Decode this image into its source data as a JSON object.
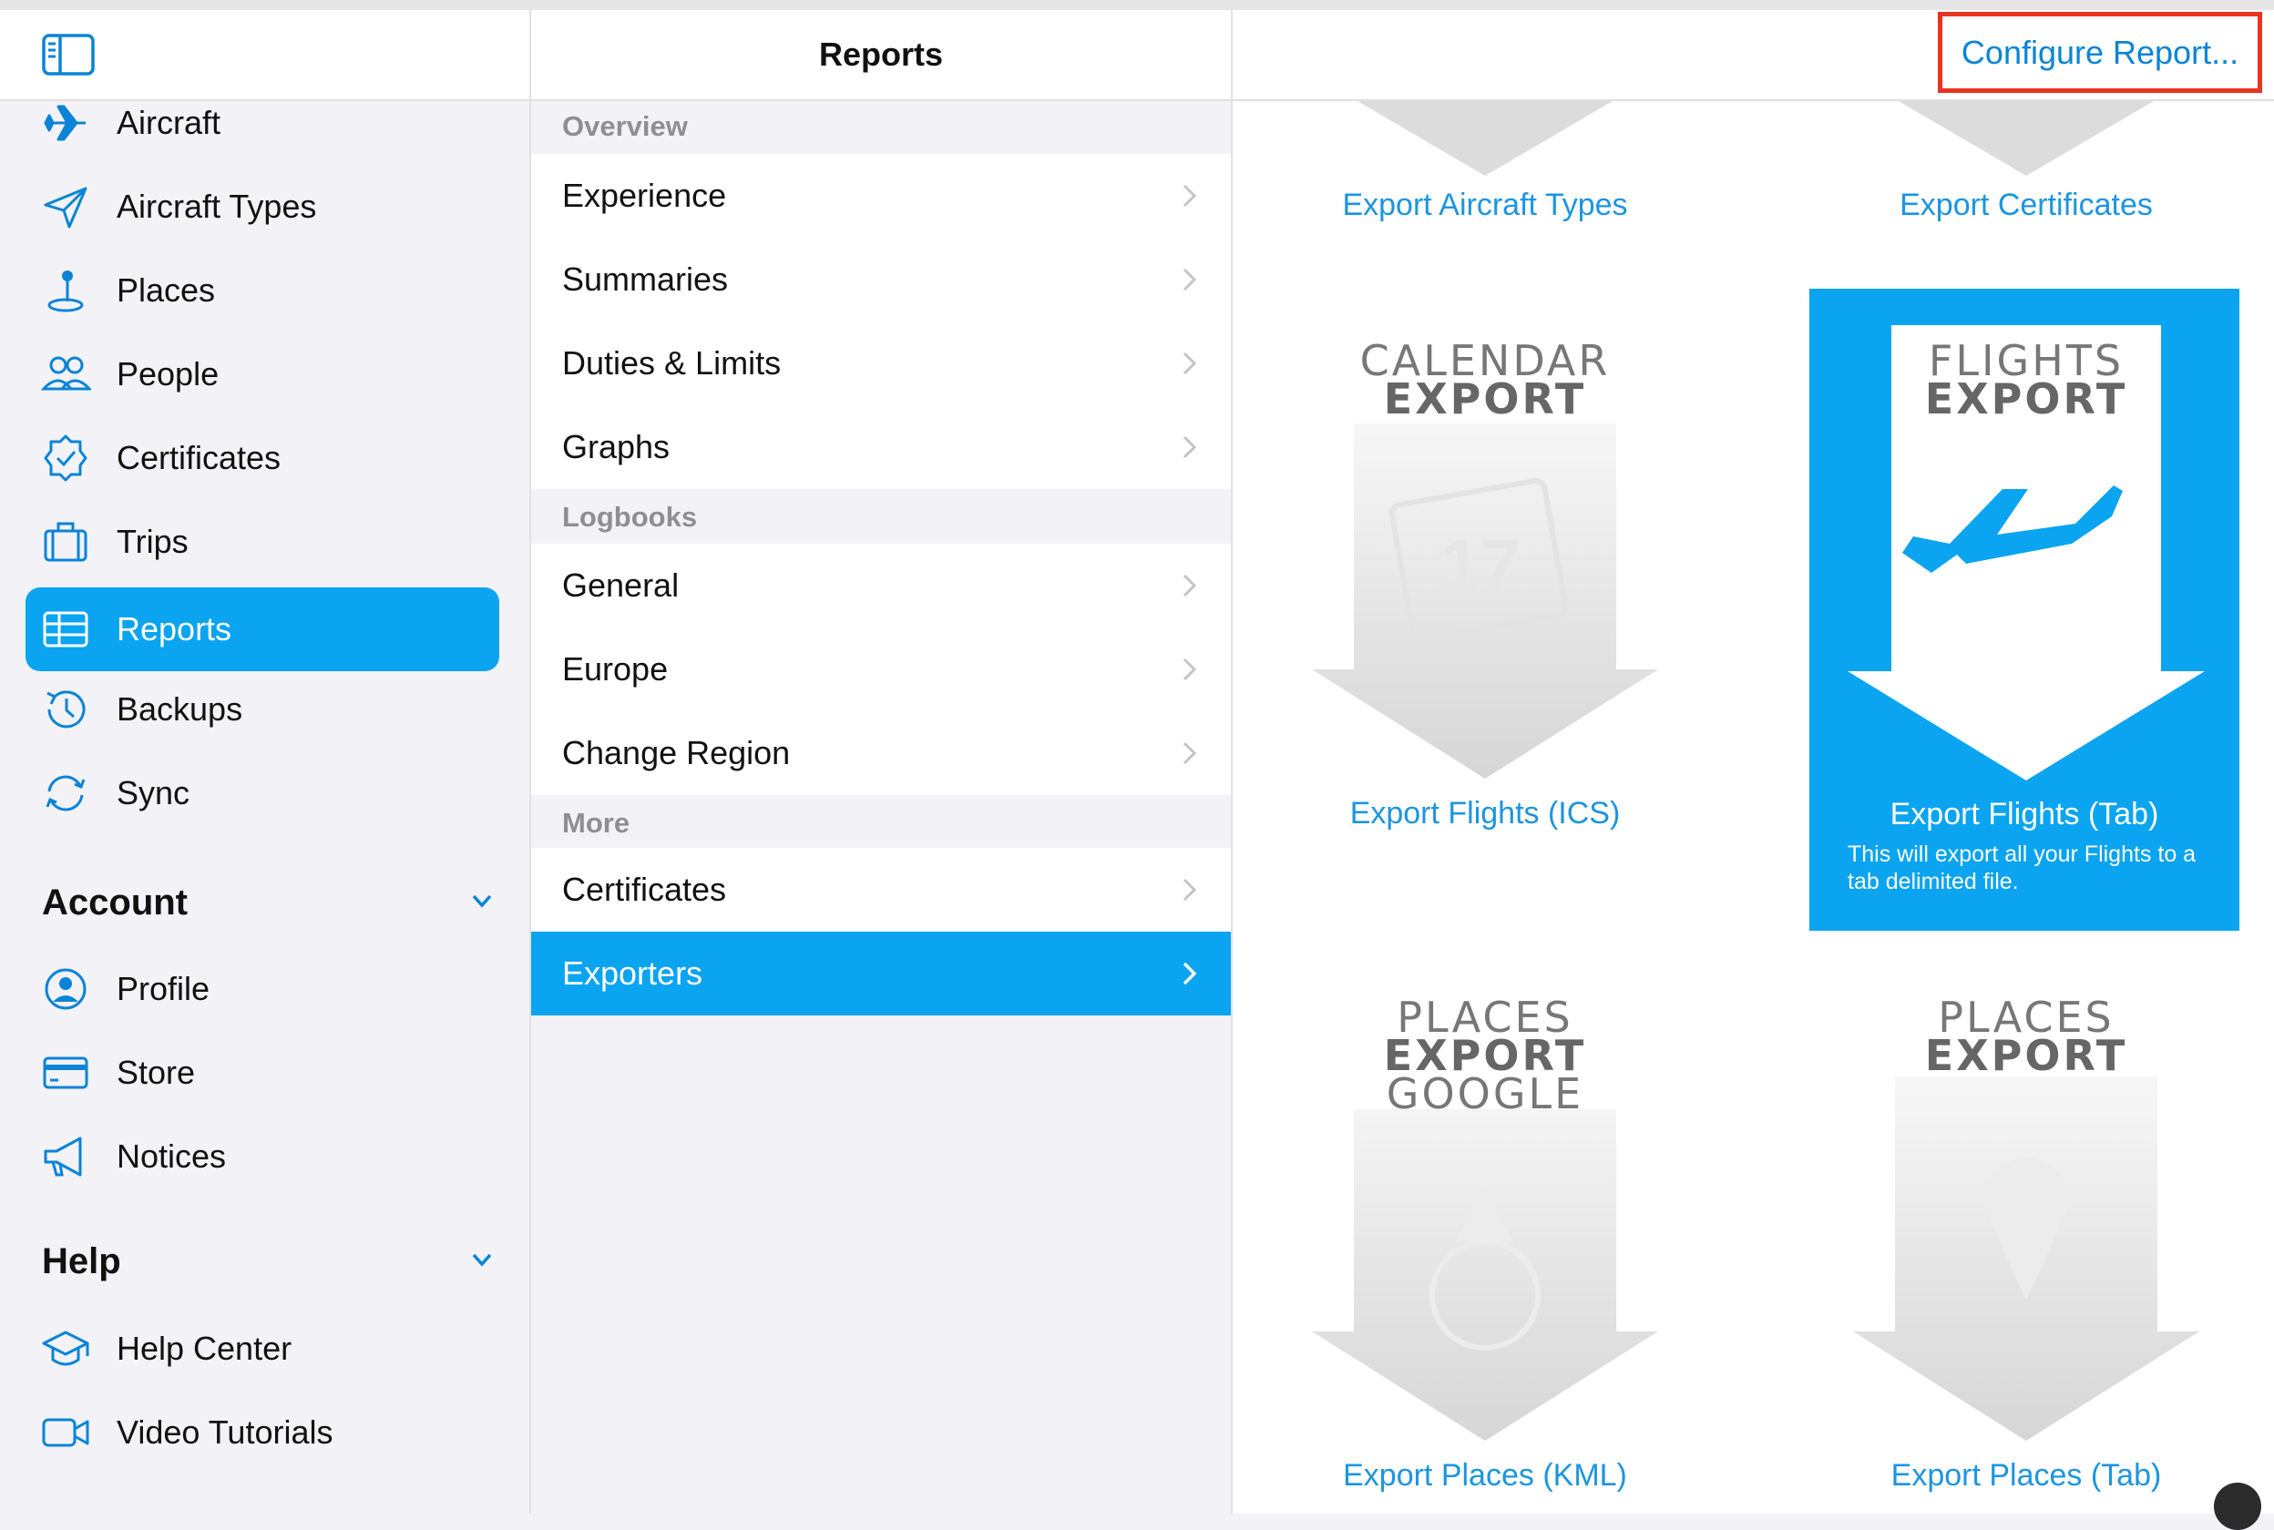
{
  "sidebar": {
    "items": [
      {
        "label": "Aircraft",
        "icon": "airplane-icon"
      },
      {
        "label": "Aircraft Types",
        "icon": "paper-plane-icon"
      },
      {
        "label": "Places",
        "icon": "map-pin-icon"
      },
      {
        "label": "People",
        "icon": "people-icon"
      },
      {
        "label": "Certificates",
        "icon": "certificate-badge-icon"
      },
      {
        "label": "Trips",
        "icon": "suitcase-icon"
      },
      {
        "label": "Reports",
        "icon": "table-icon",
        "active": true
      },
      {
        "label": "Backups",
        "icon": "clock-history-icon"
      },
      {
        "label": "Sync",
        "icon": "sync-icon"
      }
    ],
    "account": {
      "title": "Account",
      "items": [
        {
          "label": "Profile",
          "icon": "person-circle-icon"
        },
        {
          "label": "Store",
          "icon": "credit-card-icon"
        },
        {
          "label": "Notices",
          "icon": "megaphone-icon"
        }
      ]
    },
    "help": {
      "title": "Help",
      "items": [
        {
          "label": "Help Center",
          "icon": "graduation-cap-icon"
        },
        {
          "label": "Video Tutorials",
          "icon": "video-camera-icon"
        }
      ]
    }
  },
  "middle": {
    "title": "Reports",
    "groups": [
      {
        "title": "Overview",
        "rows": [
          "Experience",
          "Summaries",
          "Duties & Limits",
          "Graphs"
        ]
      },
      {
        "title": "Logbooks",
        "rows": [
          "General",
          "Europe",
          "Change Region"
        ]
      },
      {
        "title": "More",
        "rows": [
          "Certificates",
          "Exporters"
        ]
      }
    ],
    "selected": "Exporters"
  },
  "content": {
    "configure_label": "Configure Report...",
    "tiles": [
      {
        "label": "Export Aircraft Types"
      },
      {
        "label": "Export Certificates"
      },
      {
        "label": "Export Flights (ICS)",
        "art_lines": [
          "CALENDAR",
          "EXPORT"
        ],
        "art_glyph": "17"
      },
      {
        "label": "Export Flights (Tab)",
        "art_lines": [
          "FLIGHTS",
          "EXPORT"
        ],
        "description": "This will export all your Flights to a tab delimited file.",
        "selected": true
      },
      {
        "label": "Export Places (KML)",
        "art_lines": [
          "PLACES",
          "EXPORT",
          "GOOGLE"
        ]
      },
      {
        "label": "Export Places (Tab)",
        "art_lines": [
          "PLACES",
          "EXPORT"
        ]
      }
    ]
  },
  "colors": {
    "accent": "#0aa4f0",
    "link": "#1d95e0",
    "highlight_box": "#ea3323"
  }
}
